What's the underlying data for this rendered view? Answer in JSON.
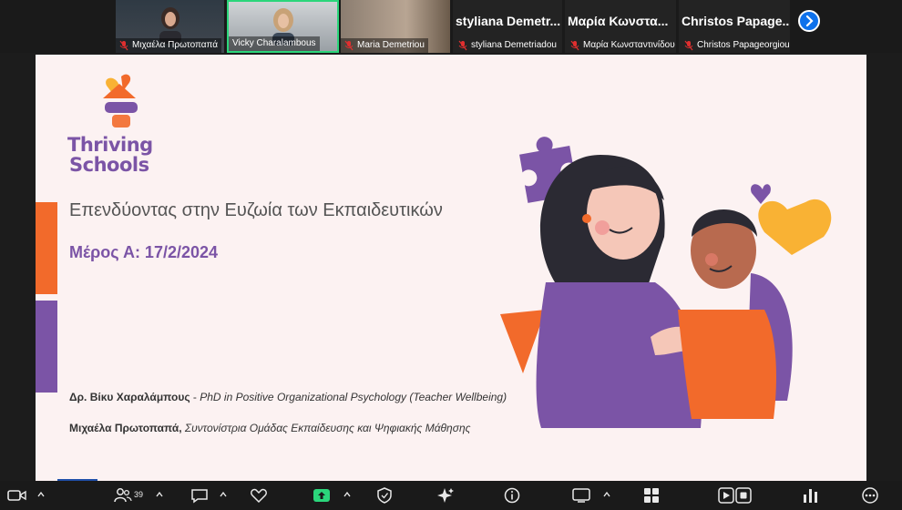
{
  "participants": [
    {
      "name": "Μιχαέλα Πρωτοπαπά",
      "muted": true,
      "video": true
    },
    {
      "name": "Vicky Charalambous",
      "muted": false,
      "video": true,
      "speaking": true
    },
    {
      "name": "Maria Demetriou",
      "muted": true,
      "video": true
    },
    {
      "display": "styliana Demetr...",
      "name": "styliana Demetriadou",
      "muted": true,
      "video": false
    },
    {
      "display": "Μαρία Κωνστα...",
      "name": "Μαρία Κωνσταντινίδου",
      "muted": true,
      "video": false
    },
    {
      "display": "Christos Papage...",
      "name": "Christos Papageorgiou",
      "muted": true,
      "video": false
    }
  ],
  "slide": {
    "logo_line1": "Thriving",
    "logo_line2": "Schools",
    "title": "Επενδύοντας στην Ευζωία των Εκπαιδευτικών",
    "subtitle": "Μέρος Α: 17/2/2024",
    "credit1_name": "Δρ. Βίκυ Χαραλάμπους",
    "credit1_sep": " - ",
    "credit1_role": "PhD in Positive Organizational Psychology  (Teacher Wellbeing)",
    "credit2_name": "Μιχαέλα Πρωτοπαπά,",
    "credit2_role": " Συντονίστρια Ομάδας Εκπαίδευσης και Ψηφιακής Μάθησης"
  },
  "toolbar": {
    "participants_count": "39"
  },
  "colors": {
    "orange": "#f26a2b",
    "purple": "#7b54a6",
    "accent_blue": "#0e71eb",
    "share_green": "#2bd67b"
  }
}
